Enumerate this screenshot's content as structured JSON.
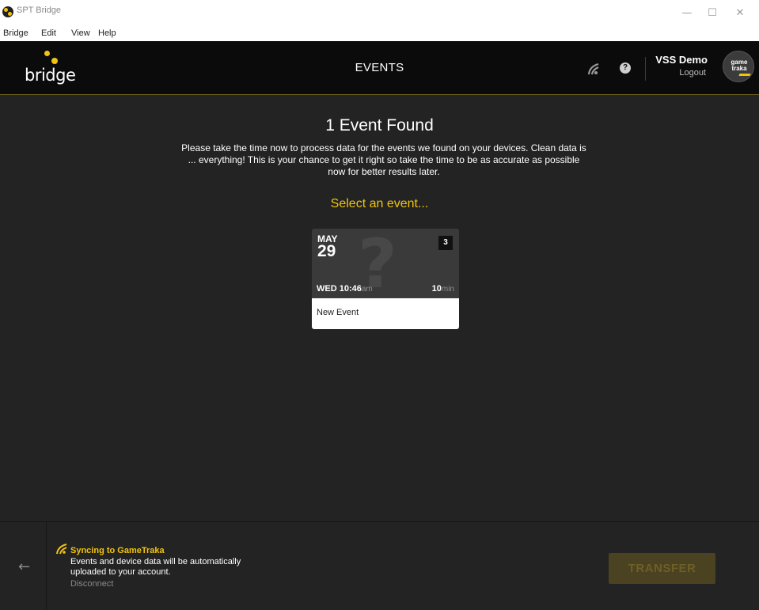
{
  "window": {
    "title": "SPT Bridge",
    "controls": {
      "minimize": "—",
      "maximize": "☐",
      "close": "✕"
    }
  },
  "menu": {
    "items": [
      "Bridge",
      "Edit",
      "View",
      "Help"
    ]
  },
  "header": {
    "logo_text": "bridge",
    "title": "EVENTS",
    "help_glyph": "?",
    "user_name": "VSS Demo",
    "logout_label": "Logout",
    "avatar_text_line1": "game",
    "avatar_text_line2": "traka",
    "icons": [
      "sync-icon",
      "help-icon"
    ]
  },
  "main": {
    "heading": "1 Event Found",
    "description": "Please take the time now to process data for the events we found on your devices. Clean data is ... everything! This is your chance to get it right so take the time to be as accurate as possible now for better results later.",
    "select_prompt": "Select an event...",
    "events": [
      {
        "month": "MAY",
        "day": "29",
        "count": "3",
        "weekday_time": "WED 10:46",
        "ampm": "am",
        "duration": "10",
        "duration_unit": "min",
        "name": "New Event",
        "placeholder_glyph": "?"
      }
    ]
  },
  "footer": {
    "back_glyph": "←",
    "sync_title": "Syncing to GameTraka",
    "sync_description": "Events and device data will be automatically uploaded to your account.",
    "disconnect_label": "Disconnect",
    "transfer_label": "TRANSFER"
  },
  "colors": {
    "accent": "#f1c40f",
    "header_bg": "#0b0b0b",
    "app_bg": "#232323",
    "card_bg": "#3a3a3a",
    "transfer_disabled_bg": "#4a4221"
  }
}
